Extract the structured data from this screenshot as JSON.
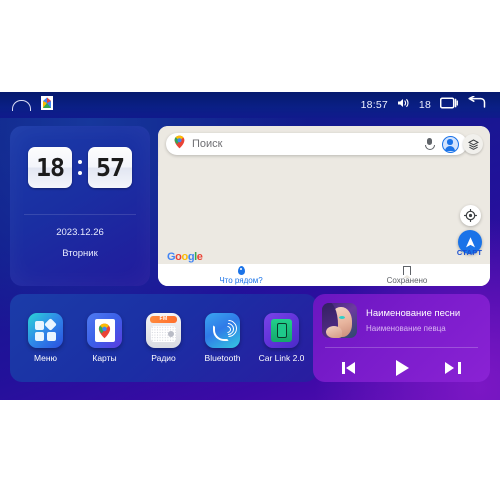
{
  "statusbar": {
    "home_icon": "home-icon",
    "notification_icon": "google-maps-pin-icon",
    "time": "18:57",
    "volume_icon": "volume-icon",
    "volume_level": "18",
    "recents_icon": "recents-icon",
    "back_icon": "back-arrow-icon"
  },
  "clock": {
    "hours": "18",
    "minutes": "57",
    "date": "2023.12.26",
    "weekday": "Вторник"
  },
  "maps": {
    "search_placeholder": "Поиск",
    "mic_icon": "microphone-icon",
    "account_icon": "account-avatar-icon",
    "layers_icon": "layers-icon",
    "compass_icon": "compass-icon",
    "start_icon": "navigation-arrow-icon",
    "start_label": "СТАРТ",
    "google_logo": [
      "G",
      "o",
      "o",
      "g",
      "l",
      "e"
    ],
    "tabs": [
      {
        "label": "Что рядом?",
        "icon": "location-pin-icon",
        "active": true
      },
      {
        "label": "Сохранено",
        "icon": "bookmark-icon",
        "active": false
      }
    ]
  },
  "dock": {
    "apps": [
      {
        "label": "Меню",
        "icon": "menu-grid-icon"
      },
      {
        "label": "Карты",
        "icon": "maps-icon"
      },
      {
        "label": "Радио",
        "icon": "radio-icon",
        "band": "FM"
      },
      {
        "label": "Bluetooth",
        "icon": "bluetooth-phone-icon"
      },
      {
        "label": "Car Link 2.0",
        "icon": "car-link-icon"
      }
    ]
  },
  "music": {
    "album_art": "album-art-woman-portrait",
    "title": "Наименование песни",
    "artist": "Наименование певца",
    "controls": [
      {
        "name": "previous-track-button",
        "icon": "skip-previous-icon"
      },
      {
        "name": "play-button",
        "icon": "play-icon"
      },
      {
        "name": "next-track-button",
        "icon": "skip-next-icon"
      }
    ]
  },
  "colors": {
    "bg_blue": "#131a8e",
    "bg_purple": "#7b17c4",
    "accent_blue": "#1a73e8",
    "music_purple": "#7a1ccb"
  }
}
